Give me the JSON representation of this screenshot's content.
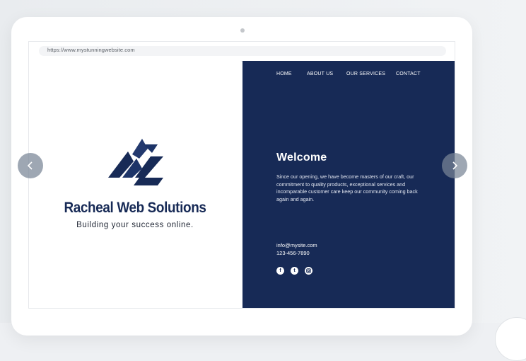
{
  "browser": {
    "url": "https://www.mystunningwebsite.com"
  },
  "brand": {
    "name": "Racheal Web Solutions",
    "tagline": "Building your success online."
  },
  "nav": {
    "items": [
      "HOME",
      "ABOUT US",
      "OUR SERVICES",
      "CONTACT"
    ]
  },
  "hero": {
    "title": "Welcome",
    "description": "Since our opening, we have become masters of our craft, our commitment to quality products, exceptional services and incomparable customer care keep our community coming back again and again."
  },
  "contact": {
    "email": "info@mysite.com",
    "phone": "123-456-7890"
  },
  "socials": {
    "icons": [
      "facebook-icon",
      "twitter-icon",
      "instagram-icon"
    ]
  },
  "colors": {
    "navy": "#172a56",
    "arrow": "#7d8796"
  }
}
